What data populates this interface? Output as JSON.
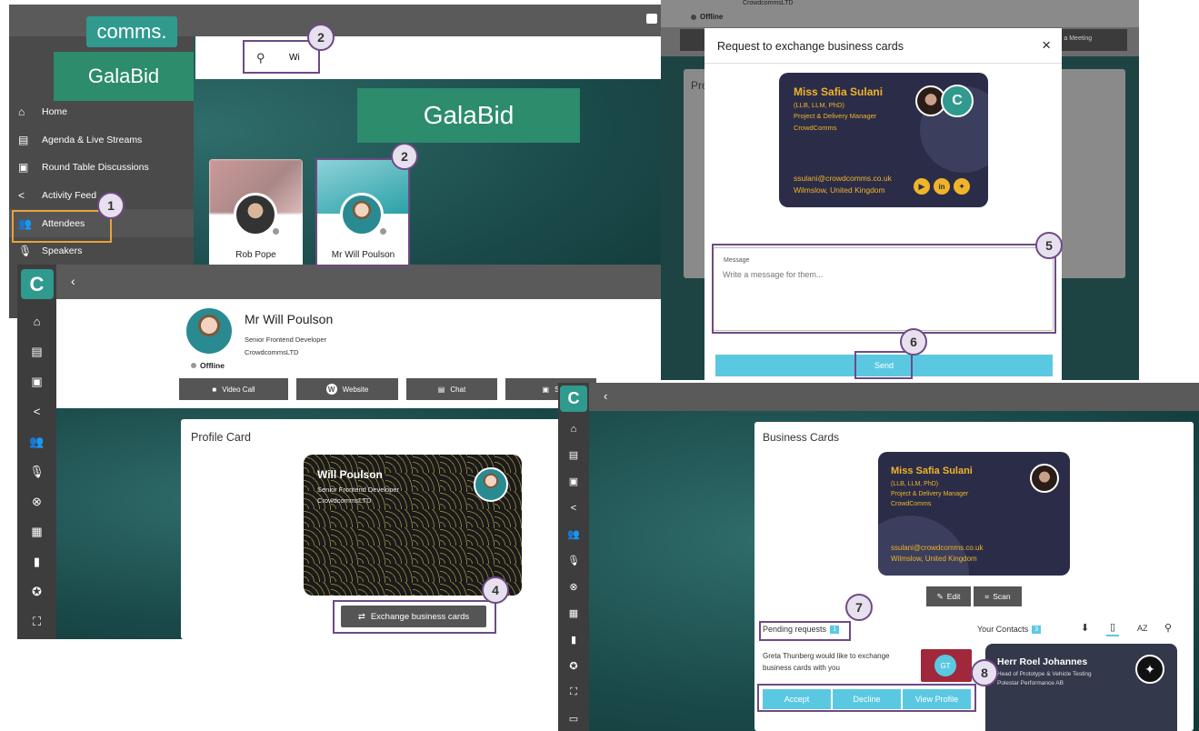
{
  "left_top": {
    "logo_comms": "comms.",
    "logo_galabid": "GalaBid",
    "banner_galabid": "GalaBid",
    "search_value": "Wi",
    "nav": [
      {
        "icon": "home-icon",
        "glyph": "⌂",
        "label": "Home"
      },
      {
        "icon": "calendar-icon",
        "glyph": "▤",
        "label": "Agenda & Live Streams"
      },
      {
        "icon": "event-icon",
        "glyph": "▣",
        "label": "Round Table Discussions"
      },
      {
        "icon": "share-icon",
        "glyph": "<",
        "label": "Activity Feed"
      },
      {
        "icon": "people-icon",
        "glyph": "👥",
        "label": "Attendees"
      },
      {
        "icon": "mic-icon",
        "glyph": "🎙",
        "label": "Speakers"
      }
    ],
    "attendees": [
      {
        "name": "Rob Pope"
      },
      {
        "name": "Mr Will Poulson"
      }
    ]
  },
  "profile": {
    "name": "Mr Will Poulson",
    "role": "Senior Frontend Developer",
    "company": "CrowdcommsLTD",
    "status": "Offline",
    "actions": [
      {
        "label": "Video Call",
        "icon": "video-icon",
        "glyph": "■"
      },
      {
        "label": "Website",
        "icon": "website-icon",
        "glyph": "W"
      },
      {
        "label": "Chat",
        "icon": "chat-icon",
        "glyph": "▤"
      },
      {
        "label": "S",
        "icon": "schedule-icon",
        "glyph": "▣"
      }
    ],
    "profile_card_title": "Profile Card",
    "card_name": "Will Poulson",
    "card_role": "Senior Frontend Developer",
    "card_company": "CrowdcommsLTD",
    "exchange_label": "Exchange business cards"
  },
  "modal": {
    "bg_status": "Offline",
    "bg_company": "CrowdcommsLTD",
    "bg_meeting": "le a Meeting",
    "bg_pro": "Pro",
    "title": "Request to exchange business cards",
    "card": {
      "name": "Miss Safia Sulani",
      "quals": "(LLB, LLM, PhD)",
      "role": "Project & Delivery Manager",
      "company": "CrowdComms",
      "email": "ssulani@crowdcomms.co.uk",
      "location": "Wilmslow, United Kingdom"
    },
    "message_label": "Message",
    "message_placeholder": "Write a message for them...",
    "send_label": "Send"
  },
  "business": {
    "title": "Business Cards",
    "card": {
      "name": "Miss Safia Sulani",
      "quals": "(LLB, LLM, PhD)",
      "role": "Project & Delivery Manager",
      "company": "CrowdComms",
      "email": "ssulani@crowdcomms.co.uk",
      "location": "Wilmslow, United Kingdom"
    },
    "edit_label": "Edit",
    "scan_label": "Scan",
    "pending_label": "Pending requests",
    "pending_count": "1",
    "contacts_label": "Your Contacts",
    "contacts_count": "3",
    "request_text": "Greta Thunberg would like to exchange business cards with you",
    "requester_initials": "GT",
    "accept_label": "Accept",
    "decline_label": "Decline",
    "view_label": "View Profile",
    "contact_name": "Herr Roel Johannes",
    "contact_role": "Head of Prototype & Vehicle Testing",
    "contact_company": "Polestar Performance AB",
    "sort_label": "AZ"
  },
  "steps": {
    "s1": "1",
    "s2a": "2",
    "s2b": "2",
    "s4": "4",
    "s5": "5",
    "s6": "6",
    "s7": "7",
    "s8": "8"
  },
  "colors": {
    "teal_dark": "#1b4a4a",
    "galabid_green": "#2c8c6c",
    "sidebar": "#3d3d3d",
    "accent_blue": "#5bc8e2",
    "card_navy": "#2b2d48",
    "gold": "#f0b429",
    "annotation_purple": "#6e4a86",
    "annotation_orange": "#e8a33c"
  }
}
